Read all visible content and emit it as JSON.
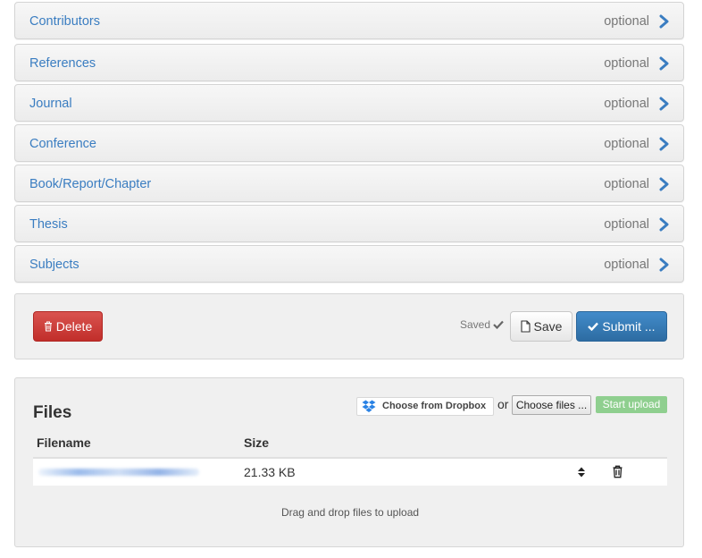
{
  "sections": [
    {
      "title": "Contributors",
      "status": "optional"
    },
    {
      "title": "References",
      "status": "optional"
    },
    {
      "title": "Journal",
      "status": "optional"
    },
    {
      "title": "Conference",
      "status": "optional"
    },
    {
      "title": "Book/Report/Chapter",
      "status": "optional"
    },
    {
      "title": "Thesis",
      "status": "optional"
    },
    {
      "title": "Subjects",
      "status": "optional"
    }
  ],
  "actions": {
    "delete_label": "Delete",
    "saved_label": "Saved",
    "save_label": "Save",
    "submit_label": "Submit ..."
  },
  "files": {
    "title": "Files",
    "dropbox_label": "Choose from Dropbox",
    "or_label": "or",
    "choose_label": "Choose files ...",
    "start_label": "Start upload",
    "col_filename": "Filename",
    "col_size": "Size",
    "rows": [
      {
        "size": "21.33 KB"
      }
    ],
    "drop_hint": "Drag and drop files to upload"
  },
  "colors": {
    "link": "#3a7dc1",
    "danger": "#d9534f",
    "primary": "#428bca",
    "success_disabled": "#8fcf8f",
    "dropbox": "#2a82e4"
  },
  "icons": {
    "chevron": "chevron-right-icon",
    "trash": "trash-icon",
    "check": "check-icon",
    "file": "file-icon",
    "dropbox": "dropbox-icon",
    "sort": "sort-icon"
  }
}
